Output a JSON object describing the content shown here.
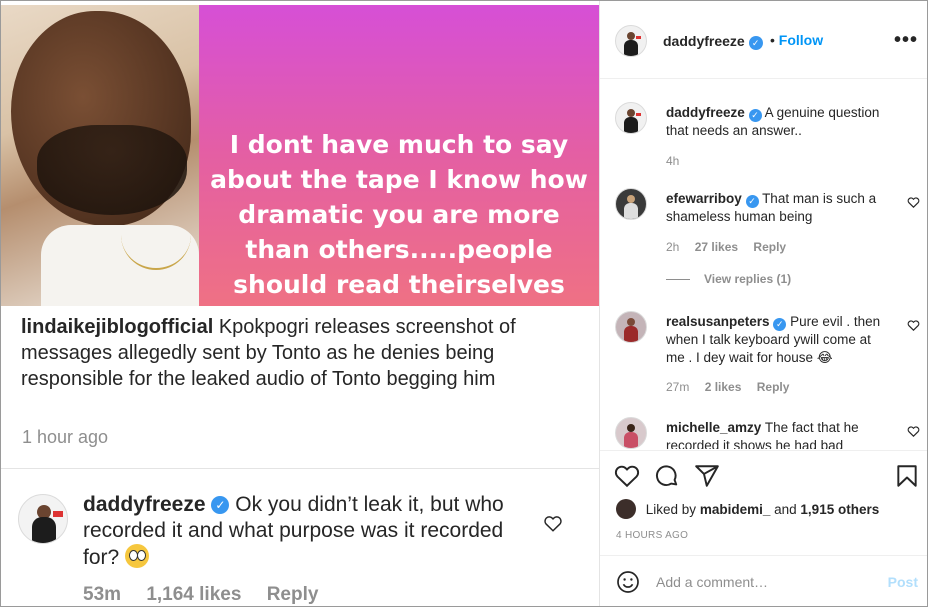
{
  "post_image": {
    "overlay_text": "I dont have much to say\nabout the tape I know how\ndramatic you are more\nthan others.....people\nshould read theirselves",
    "caption_user": "lindaikejiblogofficial",
    "caption_text": "Kpokpogri releases screenshot of messages allegedly sent by Tonto as he denies being responsible for the leaked audio of Tonto begging him",
    "time_ago": "1 hour ago",
    "comment": {
      "user": "daddyfreeze",
      "text": "Ok you didn’t leak it, but who recorded it and what purpose was it recorded for?",
      "time": "53m",
      "likes": "1,164 likes",
      "reply": "Reply"
    }
  },
  "header": {
    "username": "daddyfreeze",
    "follow": "Follow",
    "separator": "•",
    "more": "•••"
  },
  "comments": [
    {
      "user": "daddyfreeze",
      "text": "A genuine question that needs an answer..",
      "time": "4h",
      "likes": "",
      "reply": ""
    },
    {
      "user": "efewarriboy",
      "text": "That man is such a shameless human being",
      "time": "2h",
      "likes": "27 likes",
      "reply": "Reply"
    },
    {
      "user": "realsusanpeters",
      "text": "Pure evil . then when I talk keyboard ywill come at me . I dey wait for house 😂",
      "time": "27m",
      "likes": "2 likes",
      "reply": "Reply"
    },
    {
      "user": "michelle_amzy",
      "text": "The fact that he recorded it shows he had bad",
      "time": "",
      "likes": "",
      "reply": ""
    }
  ],
  "view_replies": "View replies (1)",
  "liked_by": {
    "prefix": "Liked by",
    "user": "mabidemi_",
    "and": "and",
    "others": "1,915 others"
  },
  "posted": "4 HOURS AGO",
  "add_comment": {
    "placeholder": "Add a comment…",
    "post": "Post"
  },
  "colors": {
    "link_blue": "#0095f6",
    "verified": "#3897f0",
    "gradient_top": "#d64fd6",
    "gradient_bottom": "#ef7184"
  }
}
